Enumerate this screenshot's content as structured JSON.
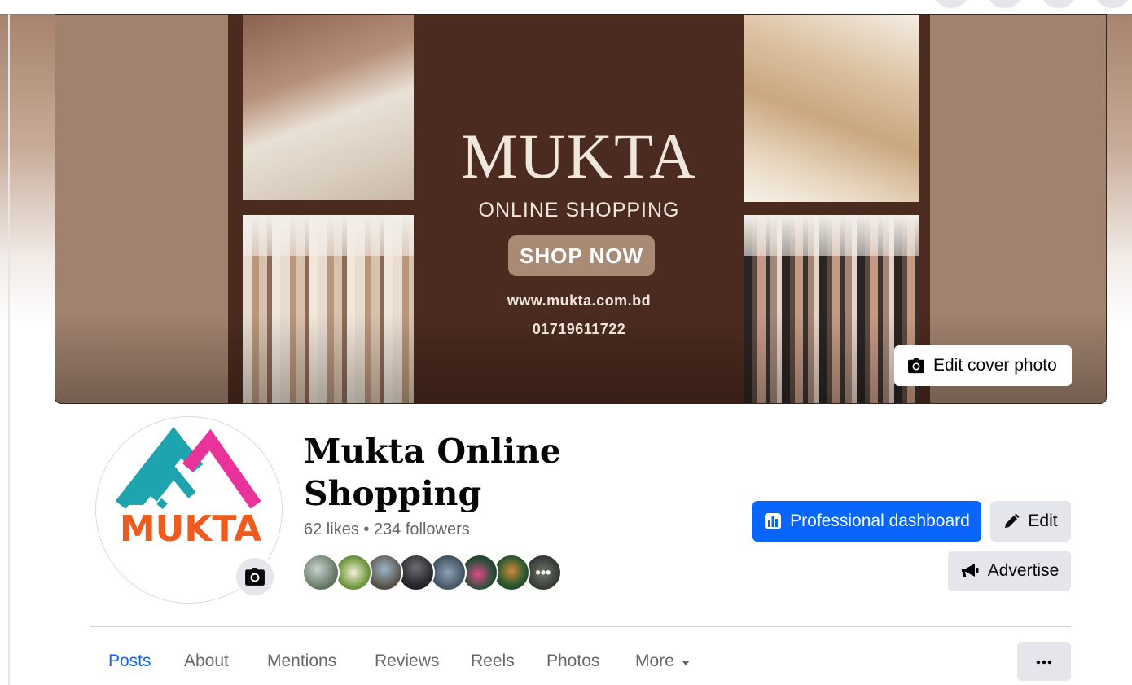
{
  "cover": {
    "title": "MUKTA",
    "subtitle": "ONLINE SHOPPING",
    "cta": "SHOP NOW",
    "website": "www.mukta.com.bd",
    "phone": "01719611722",
    "edit_label": "Edit cover photo"
  },
  "profile": {
    "logo_text": "MUKTA",
    "name": "Mukta Online Shopping",
    "likes": "62 likes",
    "separator": " • ",
    "followers": "234 followers"
  },
  "actions": {
    "dashboard_label": "Professional dashboard",
    "edit_label": "Edit",
    "advertise_label": "Advertise"
  },
  "tabs": [
    {
      "label": "Posts",
      "active": true
    },
    {
      "label": "About"
    },
    {
      "label": "Mentions"
    },
    {
      "label": "Reviews"
    },
    {
      "label": "Reels"
    },
    {
      "label": "Photos"
    },
    {
      "label": "More"
    }
  ],
  "colors": {
    "accent": "#0866ff",
    "logo_teal": "#1ea4ae",
    "logo_pink": "#e9339b",
    "logo_orange": "#ef5a1f"
  },
  "icons": [
    "camera-icon",
    "bar-chart-icon",
    "pencil-icon",
    "megaphone-icon",
    "caret-down-icon",
    "ellipsis-icon"
  ]
}
